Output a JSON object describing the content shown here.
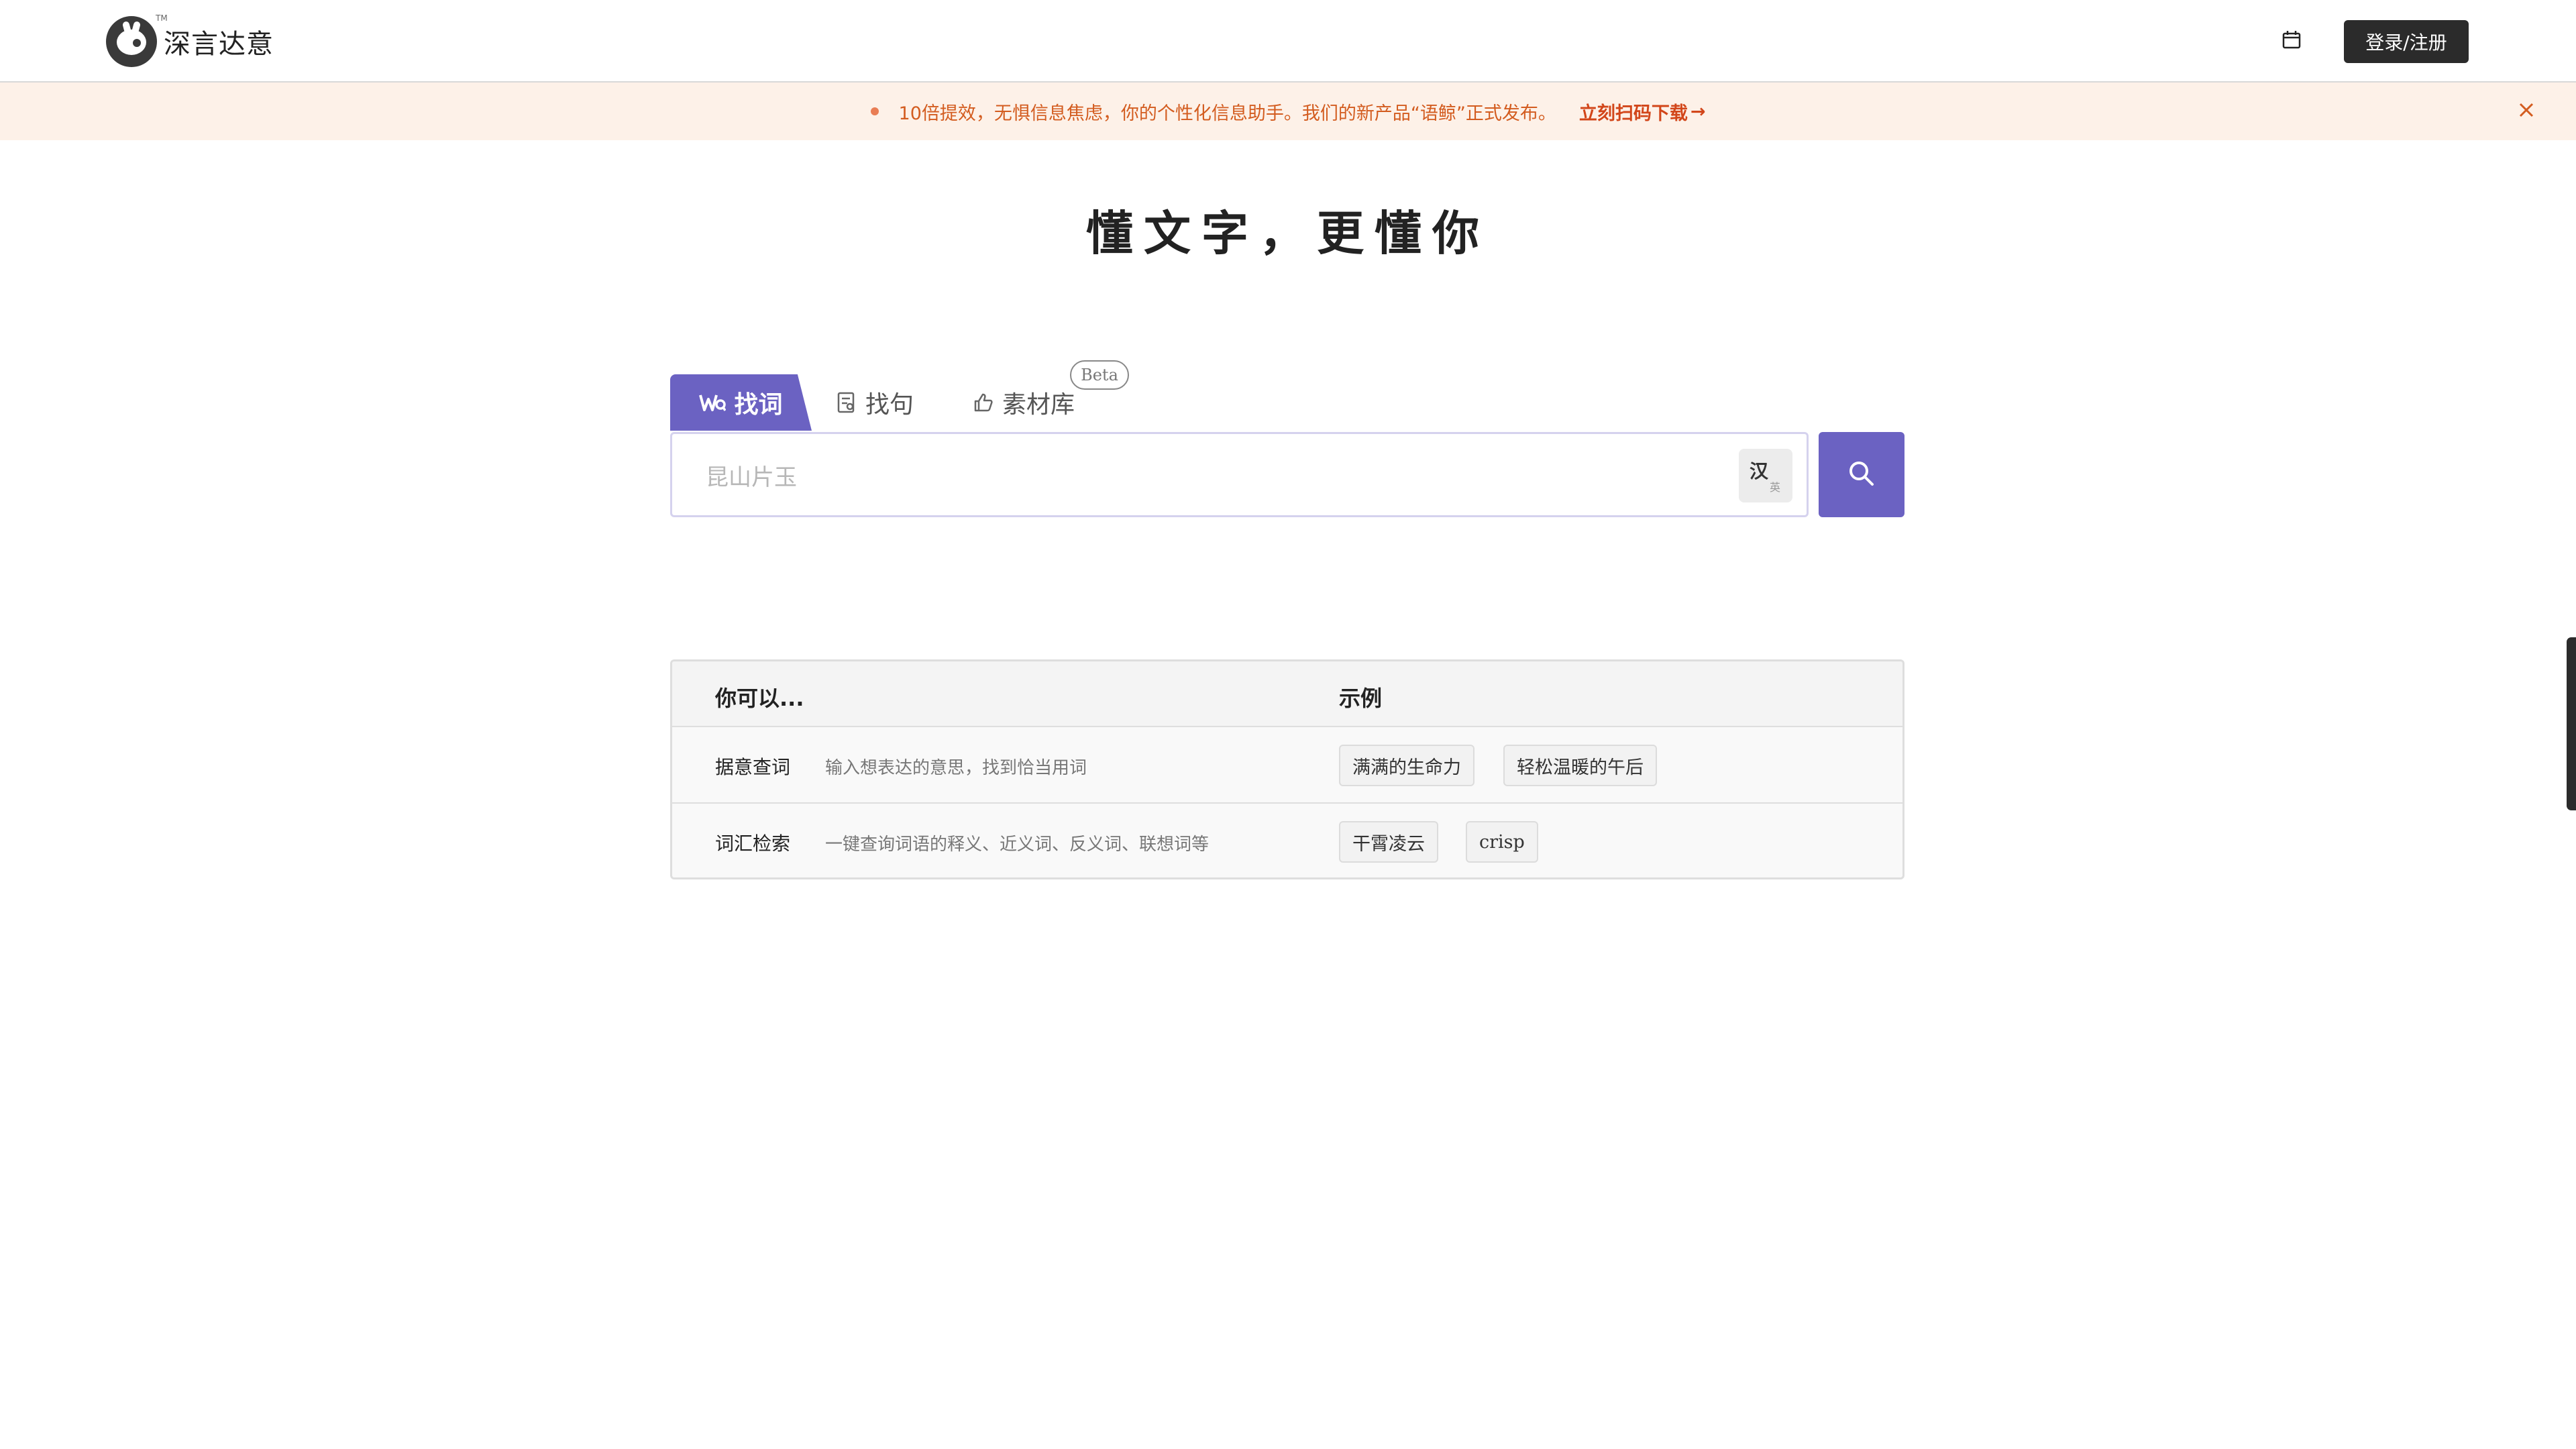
{
  "header": {
    "logo_text": "深言达意",
    "logo_tm": "TM",
    "login_label": "登录/注册"
  },
  "banner": {
    "message": "10倍提效，无惧信息焦虑，你的个性化信息助手。我们的新产品“语鲸”正式发布。",
    "link_label": "立刻扫码下载",
    "link_arrow": "→"
  },
  "hero": {
    "title": "懂文字，更懂你"
  },
  "tabs": [
    {
      "label": "找词"
    },
    {
      "label": "找句"
    },
    {
      "label": "素材库",
      "badge": "Beta"
    }
  ],
  "search": {
    "placeholder": "昆山片玉",
    "lang_main": "汉",
    "lang_sub": "英"
  },
  "table": {
    "head_left": "你可以...",
    "head_right": "示例",
    "rows": [
      {
        "title": "据意查词",
        "desc": "输入想表达的意思，找到恰当用词",
        "examples": [
          "满满的生命力",
          "轻松温暖的午后"
        ]
      },
      {
        "title": "词汇检索",
        "desc": "一键查询词语的释义、近义词、反义词、联想词等",
        "examples": [
          "干霄凌云",
          "crisp"
        ]
      }
    ]
  },
  "colors": {
    "accent": "#6b62c2",
    "banner_bg": "#fdf1e8",
    "banner_text": "#d35c1f"
  }
}
